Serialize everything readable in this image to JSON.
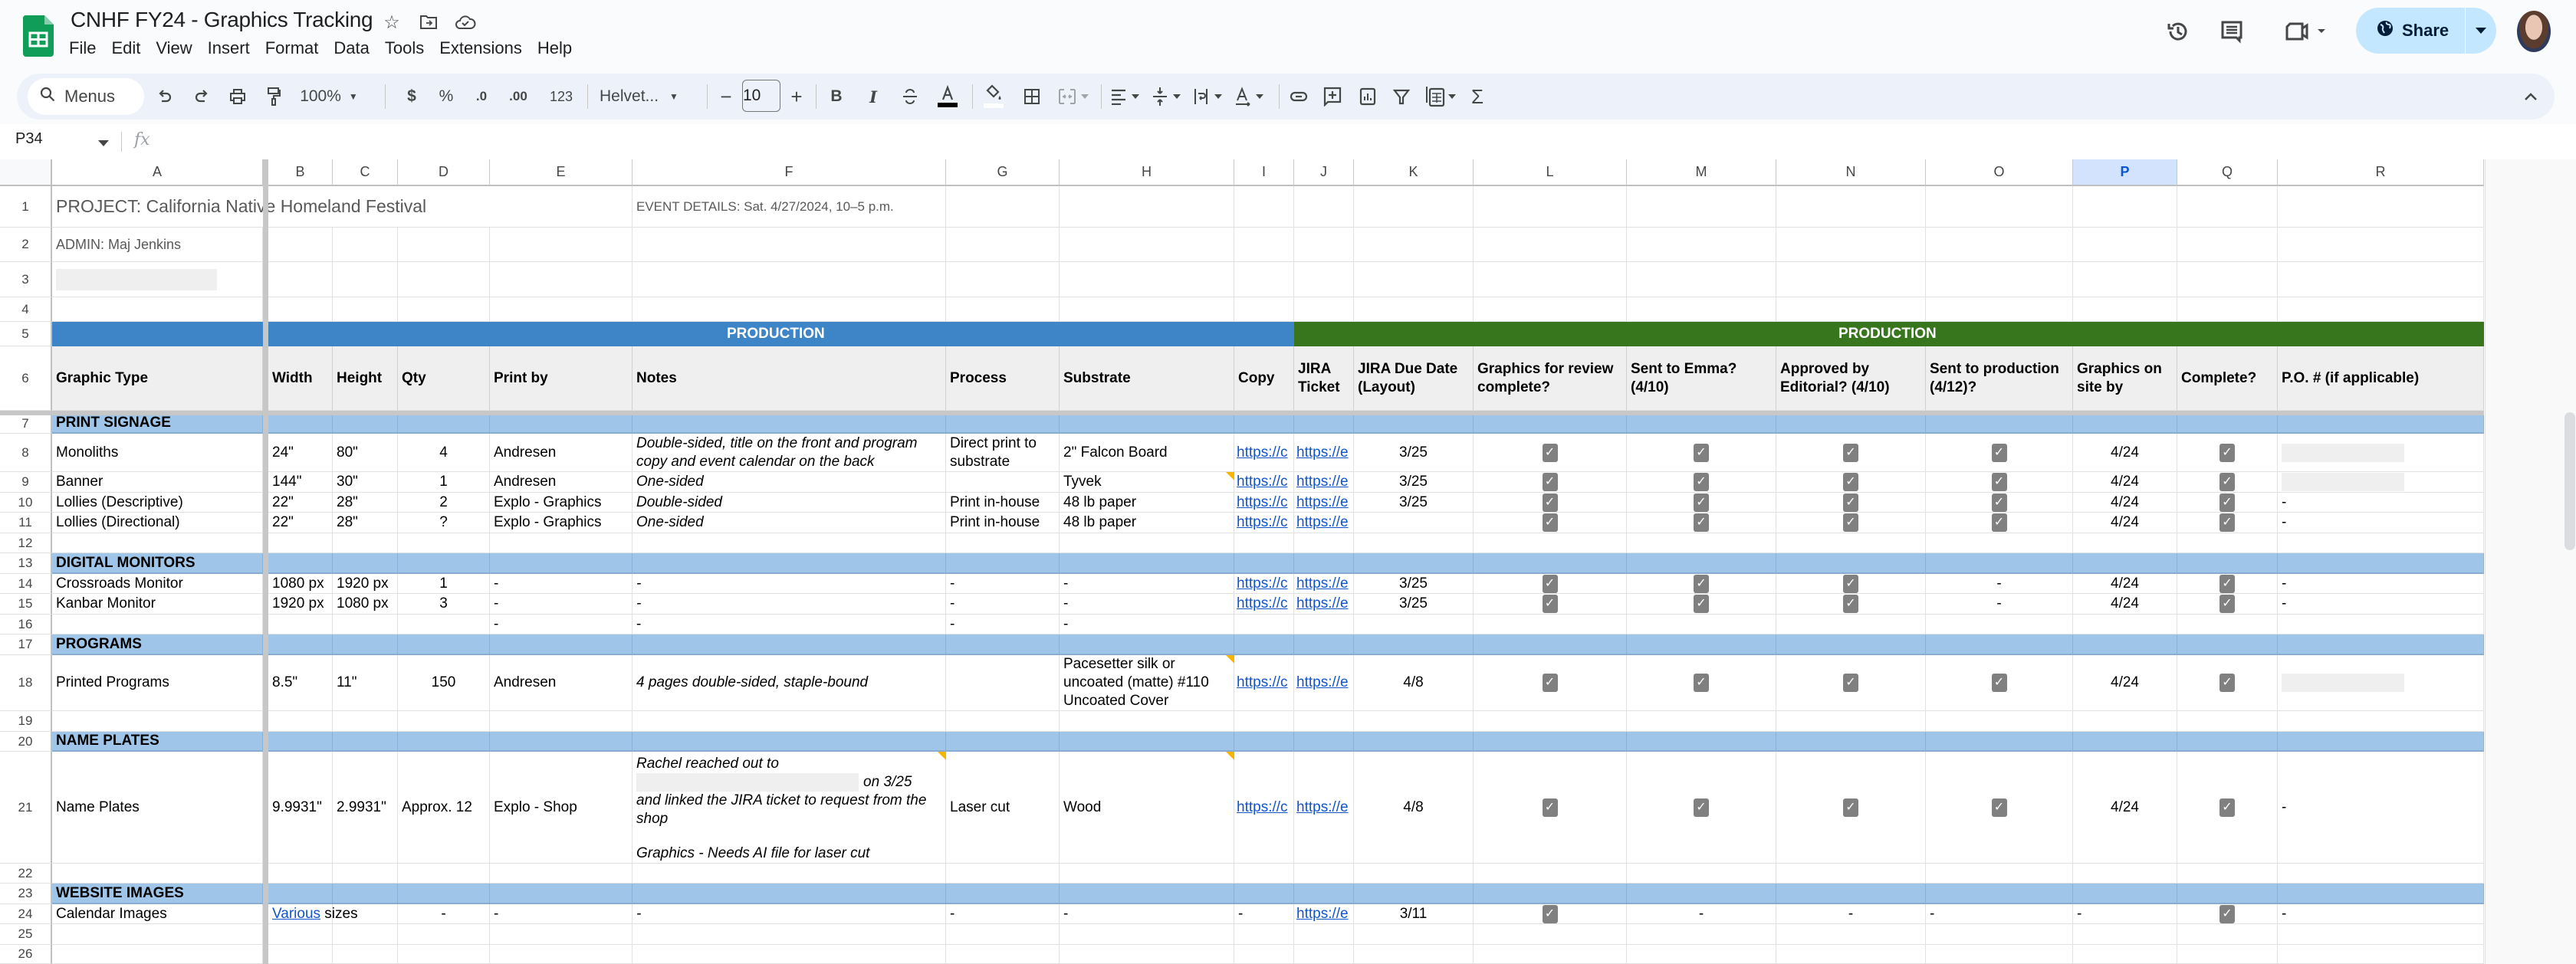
{
  "app": {
    "doc_title": "CNHF FY24 - Graphics Tracking",
    "menus": [
      "File",
      "Edit",
      "View",
      "Insert",
      "Format",
      "Data",
      "Tools",
      "Extensions",
      "Help"
    ],
    "share_label": "Share",
    "brand_color": "#0f9d58"
  },
  "toolbar": {
    "search_label": "Menus",
    "zoom": "100%",
    "currency": "$",
    "percent": "%",
    "decrease_decimal": ".0",
    "increase_decimal": ".00",
    "number_format": "123",
    "font": "Helvet...",
    "font_size": "10",
    "bold": "B",
    "italic": "I",
    "sum": "Σ"
  },
  "formula_bar": {
    "cell_ref": "P34",
    "fx": "fx",
    "value": ""
  },
  "columns": [
    "A",
    "B",
    "C",
    "D",
    "E",
    "F",
    "G",
    "H",
    "I",
    "J",
    "K",
    "L",
    "M",
    "N",
    "O",
    "P",
    "Q",
    "R"
  ],
  "selected_column": "P",
  "rows": [
    "1",
    "2",
    "3",
    "4",
    "5",
    "6",
    "7",
    "8",
    "9",
    "10",
    "11",
    "12",
    "13",
    "14",
    "15",
    "16",
    "17",
    "18",
    "19",
    "20",
    "21",
    "22",
    "23",
    "24",
    "25",
    "26"
  ],
  "sheet": {
    "project": "PROJECT: California Native Homeland Festival",
    "event": "EVENT DETAILS: Sat. 4/27/2024, 10–5 p.m.",
    "admin": "ADMIN: Maj Jenkins",
    "band_left": "PRODUCTION",
    "band_right": "PRODUCTION",
    "band_left_color": "#3d85c6",
    "band_right_color": "#38761d",
    "headers": {
      "A": "Graphic Type",
      "B": "Width",
      "C": "Height",
      "D": "Qty",
      "E": "Print by",
      "F": "Notes",
      "G": "Process",
      "H": "Substrate",
      "I": "Copy",
      "J": "JIRA Ticket",
      "K": "JIRA Due Date (Layout)",
      "L": "Graphics for review complete?",
      "M": "Sent to Emma? (4/10)",
      "N": "Approved by Editorial? (4/10)",
      "O": "Sent to production (4/12)?",
      "P": "Graphics on site by",
      "Q": "Complete?",
      "R": "P.O. # (if applicable)"
    },
    "sections": {
      "print_signage": "PRINT SIGNAGE",
      "digital_monitors": "DIGITAL MONITORS",
      "programs": "PROGRAMS",
      "name_plates": "NAME PLATES",
      "website_images": "WEBSITE IMAGES"
    },
    "r8": {
      "A": "Monoliths",
      "B": "24\"",
      "C": "80\"",
      "D": "4",
      "E": "Andresen",
      "F": "Double-sided, title on the front and program copy and event calendar on the back",
      "G": "Direct print to substrate",
      "H": "2\" Falcon Board",
      "I": "https://c",
      "J": "https://e",
      "K": "3/25",
      "L": true,
      "M": true,
      "N": true,
      "O": true,
      "P": "4/24",
      "Q": true,
      "R": ""
    },
    "r9": {
      "A": "Banner",
      "B": "144\"",
      "C": "30\"",
      "D": "1",
      "E": "Andresen",
      "F": "One-sided",
      "G": "",
      "H": "Tyvek",
      "I": "https://c",
      "J": "https://e",
      "K": "3/25",
      "L": true,
      "M": true,
      "N": true,
      "O": true,
      "P": "4/24",
      "Q": true,
      "R": ""
    },
    "r10": {
      "A": "Lollies (Descriptive)",
      "B": "22\"",
      "C": "28\"",
      "D": "2",
      "E": "Explo - Graphics",
      "F": "Double-sided",
      "G": "Print in-house",
      "H": "48 lb paper",
      "I": "https://c",
      "J": "https://e",
      "K": "3/25",
      "L": true,
      "M": true,
      "N": true,
      "O": true,
      "P": "4/24",
      "Q": true,
      "R": "-"
    },
    "r11": {
      "A": "Lollies (Directional)",
      "B": "22\"",
      "C": "28\"",
      "D": "?",
      "E": "Explo - Graphics",
      "F": "One-sided",
      "G": "Print in-house",
      "H": "48 lb paper",
      "I": "https://c",
      "J": "https://e",
      "K": "",
      "L": true,
      "M": true,
      "N": true,
      "O": true,
      "P": "4/24",
      "Q": true,
      "R": "-"
    },
    "r14": {
      "A": "Crossroads Monitor",
      "B": "1080 px",
      "C": "1920 px",
      "D": "1",
      "E": "-",
      "F": "-",
      "G": "-",
      "H": "-",
      "I": "https://c",
      "J": "https://e",
      "K": "3/25",
      "L": true,
      "M": true,
      "N": true,
      "O": "-",
      "P": "4/24",
      "Q": true,
      "R": "-"
    },
    "r15": {
      "A": "Kanbar Monitor",
      "B": "1920 px",
      "C": "1080 px",
      "D": "3",
      "E": "-",
      "F": "-",
      "G": "-",
      "H": "-",
      "I": "https://c",
      "J": "https://e",
      "K": "3/25",
      "L": true,
      "M": true,
      "N": true,
      "O": "-",
      "P": "4/24",
      "Q": true,
      "R": "-"
    },
    "r16": {
      "E": "-",
      "F": "-",
      "G": "-",
      "H": "-"
    },
    "r18": {
      "A": "Printed Programs",
      "B": "8.5\"",
      "C": "11\"",
      "D": "150",
      "E": "Andresen",
      "F": "4 pages double-sided, staple-bound",
      "G": "",
      "H": "Pacesetter silk or uncoated (matte) #110 Uncoated Cover",
      "I": "https://c",
      "J": "https://e",
      "K": "4/8",
      "L": true,
      "M": true,
      "N": true,
      "O": true,
      "P": "4/24",
      "Q": true,
      "R": ""
    },
    "r21": {
      "A": "Name Plates",
      "B": "9.9931\"",
      "C": "2.9931\"",
      "D": "Approx. 12",
      "E": "Explo - Shop",
      "F_line1": "Rachel reached out to",
      "F_line2": "on 3/25",
      "F_line3": "and linked the JIRA ticket to request from the shop",
      "F_line4": "Graphics - Needs AI file for laser cut",
      "G": "Laser cut",
      "H": "Wood",
      "I": "https://c",
      "J": "https://e",
      "K": "4/8",
      "L": true,
      "M": true,
      "N": true,
      "O": true,
      "P": "4/24",
      "Q": true,
      "R": "-"
    },
    "r24": {
      "A": "Calendar Images",
      "B_link": "Various",
      "B_rest": " sizes",
      "D": "-",
      "E": "-",
      "F": "-",
      "G": "-",
      "H": "-",
      "I": "-",
      "J": "https://e",
      "K": "3/11",
      "L": true,
      "M": "-",
      "N": "-",
      "O": "-",
      "P": "-",
      "Q": true,
      "R": "-"
    }
  }
}
